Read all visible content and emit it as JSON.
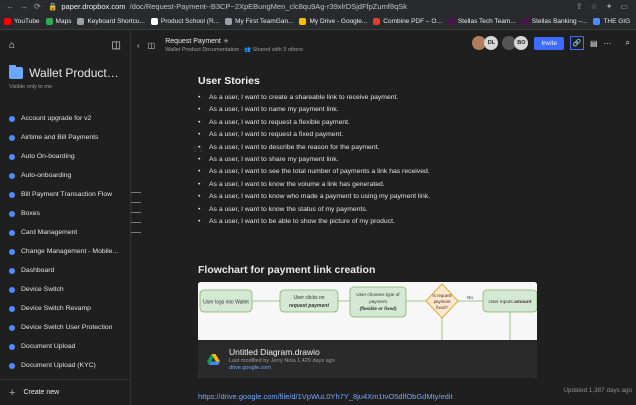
{
  "browser": {
    "host": "paper.dropbox.com",
    "path": "/doc/Request-Payment--B3CP~2XpEBungMen_clc8qu9Ag-r39xlrDSjdFfpZumf8qSk"
  },
  "bookmarks": [
    {
      "label": "YouTube",
      "color": "#ff0000"
    },
    {
      "label": "Maps",
      "color": "#34a853"
    },
    {
      "label": "Keyboard Shortcu...",
      "color": "#9aa0a6"
    },
    {
      "label": "Product School (R...",
      "color": "#ffffff"
    },
    {
      "label": "My First TeamGan...",
      "color": "#9aa0a6"
    },
    {
      "label": "My Drive - Google...",
      "color": "#fbbc04"
    },
    {
      "label": "Combine PDF – O...",
      "color": "#e33b2e"
    },
    {
      "label": "Stellas Tech Team...",
      "color": "#4a154b"
    },
    {
      "label": "Stellas Banking –...",
      "color": "#4a154b"
    },
    {
      "label": "THE GIG",
      "color": "#4d8cff"
    }
  ],
  "sidebar": {
    "folder_title": "Wallet Product Do...",
    "visibility": "Visible only to me",
    "items": [
      "Account upgrade for v2",
      "Airtime and Bill Payments",
      "Auto On-boarding",
      "Auto-onboarding",
      "Bill Payment Transaction Flow",
      "Boxes",
      "Card Management",
      "Change Management - Mobile...",
      "Dashboard",
      "Device Switch",
      "Device Switch Revamp",
      "Device Switch User Protection",
      "Document Upload",
      "Document Upload (KYC)"
    ],
    "create_new": "Create new"
  },
  "doc_header": {
    "title": "Request Payment",
    "folder": "Wallet Product Documentation",
    "shared": "Shared with 3 others",
    "avatars": [
      "DL",
      "BO"
    ],
    "invite": "Invite"
  },
  "content": {
    "user_stories_heading": "User Stories",
    "stories": [
      "As a user, I want to create a shareable link to receive payment.",
      "As a user, I want to name my payment link.",
      "As a user, I want to request a flexible payment.",
      "As a user, I want to request a fixed payment.",
      "As a user, I want to describe the reason for the payment.",
      "As a user, I want to share my payment link.",
      "As a user, I want to see the total number of payments a link has received.",
      "As a user, I want to know the volume a link has generated.",
      "As a user, I want to know who made a payment to using my payment link.",
      "As a user, I want to know the status of my payments.",
      "As a user, I want to be able to show the picture of my product."
    ],
    "flowchart_heading": "Flowchart for payment link creation",
    "diagram": {
      "n1": "User logs into Wallet",
      "n2a": "User clicks on",
      "n2b": "request payment",
      "n3a": "User chooses type of",
      "n3b": "payment",
      "n3c": "(flexible or fixed)",
      "n4a": "Is request",
      "n4b": "payment",
      "n4c": "fixed?",
      "no": "No",
      "n5a": "User inputs",
      "n5b": "amount"
    },
    "file_title": "Untitled Diagram.drawio",
    "file_meta": "Last modified by Jerry Nola 1,429 days ago",
    "file_source": "drive.google.com",
    "drive_url": "https://drive.google.com/file/d/1VpWuL0Yh7Y_8ju4Xm1tvO5dlfObGdMty/edit",
    "updated": "Updated 1,387 days ago"
  }
}
